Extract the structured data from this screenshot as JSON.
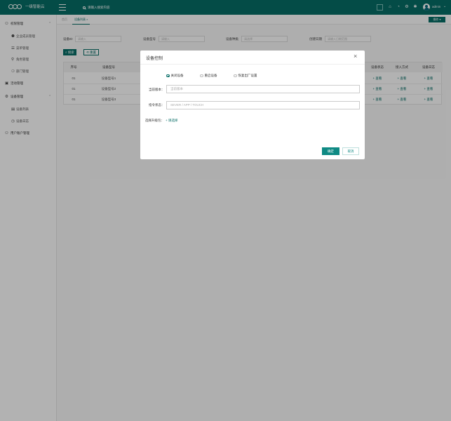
{
  "header": {
    "app_title": "一级智能云",
    "search_placeholder": "请输入搜索内容",
    "user_name": "admin",
    "icons": [
      "fullscreen-icon",
      "lock-icon",
      "bell-icon",
      "gear-icon",
      "theme-icon"
    ]
  },
  "sidebar": {
    "groups": [
      {
        "label": "权限管理",
        "icon": "user-icon",
        "items": [
          "企业成员管理",
          "菜单管理",
          "角色管理",
          "部门管理"
        ]
      },
      {
        "label": "活动管理",
        "icon": "activity-icon",
        "items": []
      },
      {
        "label": "设备管理",
        "icon": "gear-icon",
        "items": [
          "设备列表",
          "设备日志"
        ]
      },
      {
        "label": "用户账户管理",
        "icon": "user-icon",
        "items": []
      }
    ]
  },
  "tabs": {
    "home": "首页",
    "active": "设备列表 ×",
    "ops_button": "操作 ▾"
  },
  "filters": {
    "device_id_label": "设备ID",
    "device_id_placeholder": "请输入",
    "device_model_label": "设备型号",
    "device_model_placeholder": "请输入",
    "device_state_label": "设备种类",
    "device_state_placeholder": "请选择",
    "bind_time_label": "创建日期",
    "bind_time_placeholder": "请输入日期范围",
    "search_button": "搜索",
    "reset_button": "重置"
  },
  "table": {
    "columns": [
      "序号",
      "设备型号",
      "设备状态",
      "接入方式",
      "设备日志"
    ],
    "rows": [
      {
        "no": "01",
        "model": "设备型号1",
        "state": "+ 查看",
        "access": "+ 查看",
        "log": "+ 查看"
      },
      {
        "no": "01",
        "model": "设备型号2",
        "state": "+ 查看",
        "access": "+ 查看",
        "log": "+ 查看"
      },
      {
        "no": "01",
        "model": "设备型号3",
        "state": "+ 查看",
        "access": "+ 查看",
        "log": "+ 查看"
      }
    ]
  },
  "modal": {
    "title": "设备控制",
    "radios": [
      {
        "label": "关闭设备",
        "checked": true
      },
      {
        "label": "重启设备",
        "checked": false
      },
      {
        "label": "恢复出厂设置",
        "checked": false
      }
    ],
    "version_label": "当前版本：",
    "version_placeholder": "当前版本",
    "command_label": "指令状态：",
    "command_placeholder": "SEVER / APP / TOUCH",
    "upgrade_label": "选择升级包：",
    "choose_link": "+ 请选择",
    "ok_button": "确定",
    "cancel_button": "取消"
  }
}
